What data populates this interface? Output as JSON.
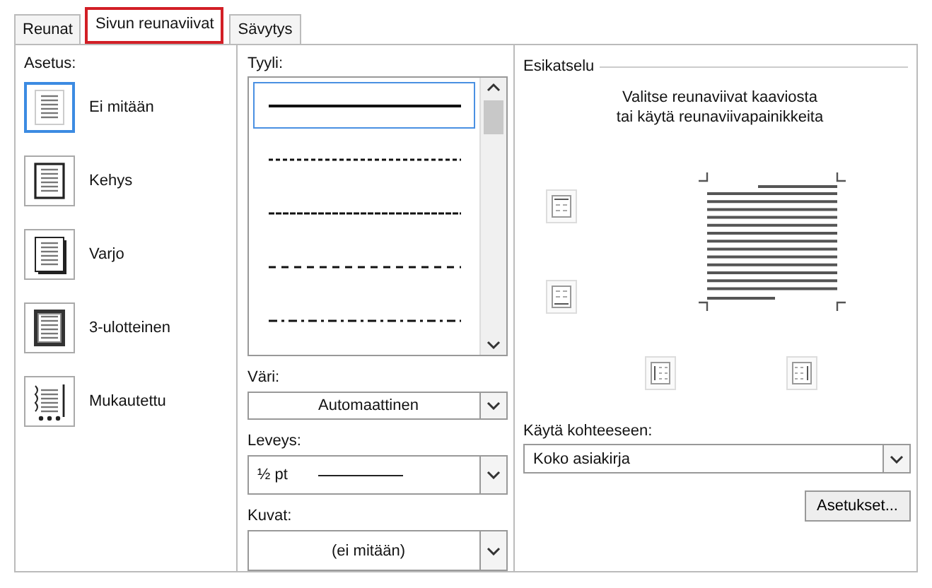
{
  "tabs": [
    {
      "label": "Reunat",
      "selected": false
    },
    {
      "label": "Sivun reunaviivat",
      "selected": true
    },
    {
      "label": "Sävytys",
      "selected": false
    }
  ],
  "setting": {
    "label": "Asetus:",
    "items": [
      {
        "label": "Ei mitään",
        "kind": "none",
        "selected": true
      },
      {
        "label": "Kehys",
        "kind": "box",
        "selected": false
      },
      {
        "label": "Varjo",
        "kind": "shadow",
        "selected": false
      },
      {
        "label": "3-ulotteinen",
        "kind": "threed",
        "selected": false
      },
      {
        "label": "Mukautettu",
        "kind": "custom",
        "selected": false
      }
    ]
  },
  "style": {
    "label": "Tyyli:",
    "options": [
      {
        "kind": "solid",
        "selected": true
      },
      {
        "kind": "dotted",
        "selected": false
      },
      {
        "kind": "fine-dash",
        "selected": false
      },
      {
        "kind": "dashed",
        "selected": false
      },
      {
        "kind": "dash-dot",
        "selected": false
      }
    ]
  },
  "color": {
    "label": "Väri:",
    "value": "Automaattinen"
  },
  "width": {
    "label": "Leveys:",
    "value": "½ pt"
  },
  "art": {
    "label": "Kuvat:",
    "value": "(ei mitään)"
  },
  "preview": {
    "title": "Esikatselu",
    "hint": "Valitse reunaviivat kaaviosta\ntai käytä reunaviivapainikkeita"
  },
  "apply_to": {
    "label": "Käytä kohteeseen:",
    "value": "Koko asiakirja"
  },
  "options_button": "Asetukset..."
}
